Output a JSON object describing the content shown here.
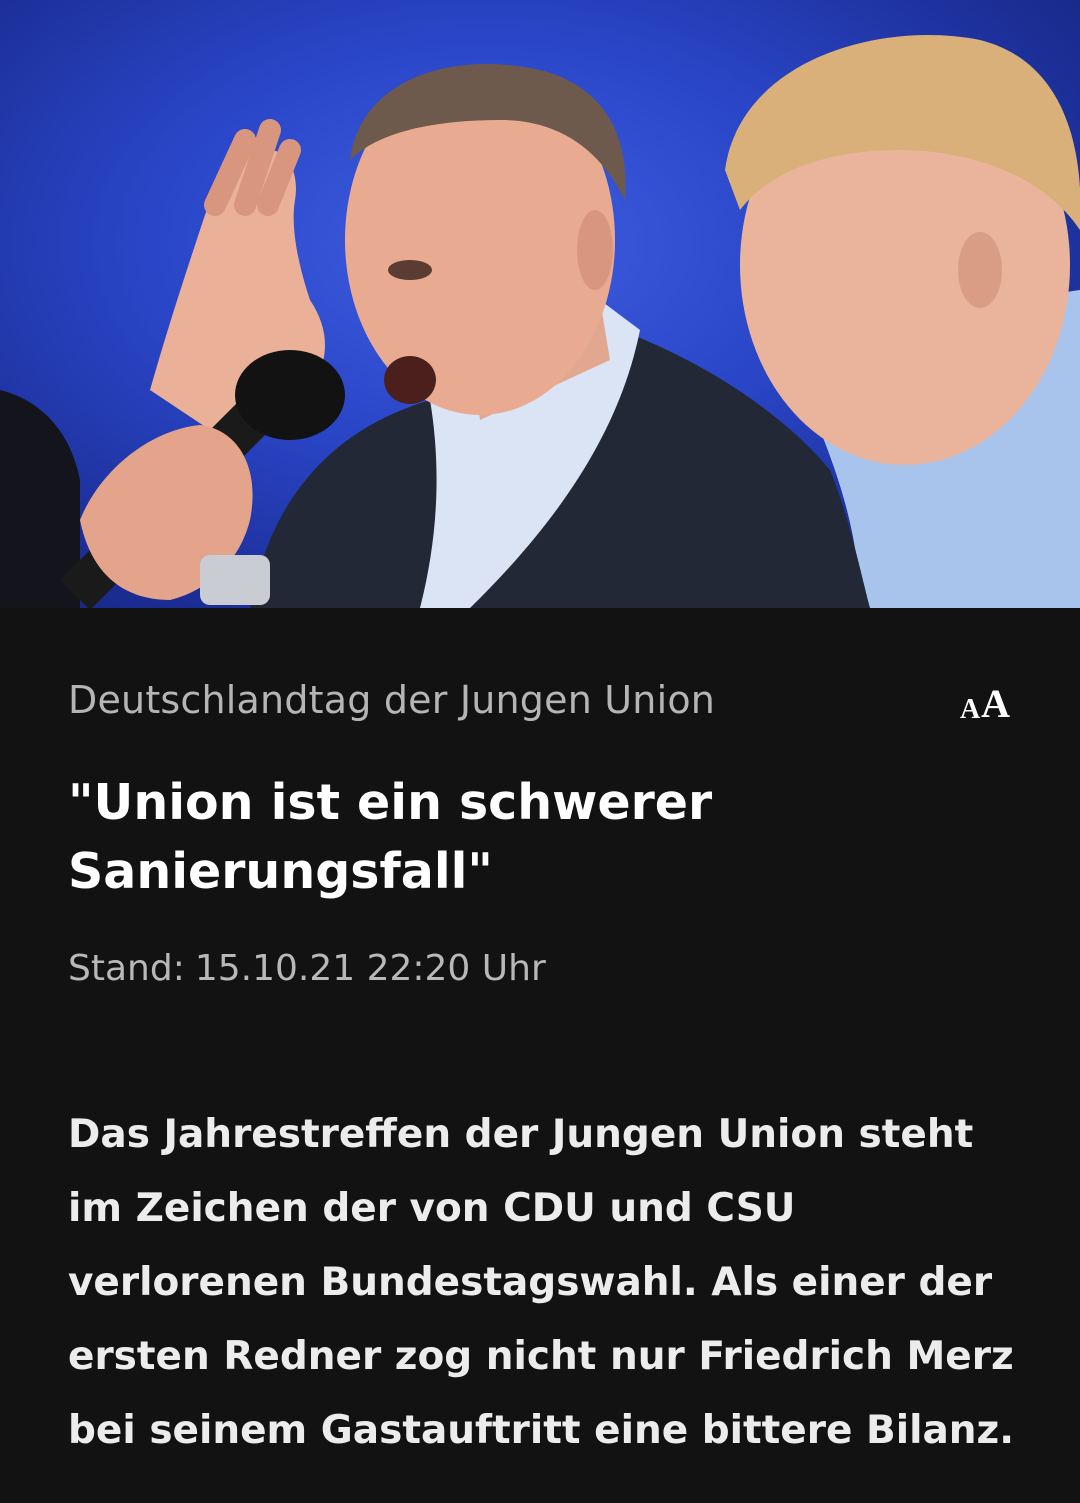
{
  "article": {
    "image_alt": "Friedrich Merz spricht am Mikrofon",
    "topline": "Deutschlandtag der Jungen Union",
    "font_size_toggle": {
      "small": "A",
      "large": "A"
    },
    "headline": "\"Union ist ein schwerer Sanierungsfall\"",
    "stand_label": "Stand:",
    "stand_value": "15.10.21 22:20 Uhr",
    "teaser": "Das Jahrestreffen der Jungen Union steht im Zeichen der von CDU und CSU verlorenen Bundestagswahl. Als einer der ersten Redner zog nicht nur Friedrich Merz bei seinem Gastauftritt eine bittere Bilanz."
  },
  "colors": {
    "background": "#121212",
    "hero_blue": "#2a46c8",
    "topline_text": "#b5b5b5",
    "headline_text": "#ffffff"
  }
}
